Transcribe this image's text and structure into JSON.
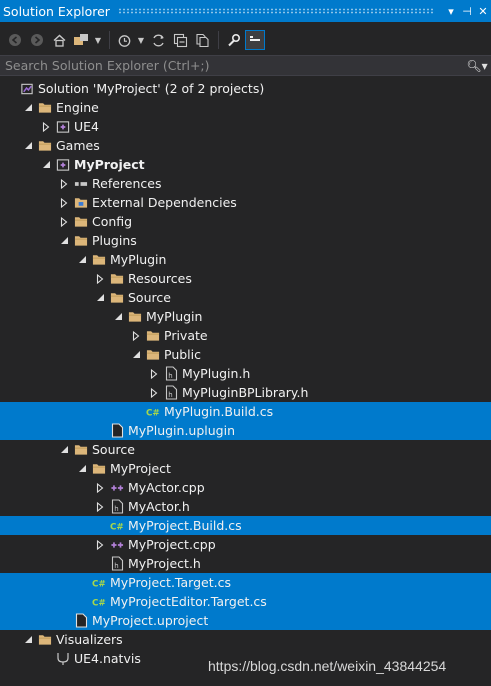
{
  "window": {
    "title": "Solution Explorer",
    "buttons": [
      "▾",
      "⊣",
      "✕"
    ]
  },
  "search": {
    "placeholder": "Search Solution Explorer (Ctrl+;)",
    "value": ""
  },
  "colors": {
    "accent": "#007acc",
    "background": "#252526",
    "folder": "#dcb67a",
    "cs": "#a6d74c",
    "cpp": "#b180d7"
  },
  "tree": [
    {
      "label": "Solution 'MyProject' (2 of 2 projects)",
      "icon": "solution-icon",
      "expander": "none",
      "indent": 0
    },
    {
      "label": "Engine",
      "icon": "folder-icon",
      "expander": "expanded",
      "indent": 1
    },
    {
      "label": "UE4",
      "icon": "cpp-project-icon",
      "expander": "collapsed",
      "indent": 2
    },
    {
      "label": "Games",
      "icon": "folder-icon",
      "expander": "expanded",
      "indent": 1
    },
    {
      "label": "MyProject",
      "icon": "cpp-project-icon",
      "expander": "expanded",
      "indent": 2,
      "bold": true
    },
    {
      "label": "References",
      "icon": "references-icon",
      "expander": "collapsed",
      "indent": 3
    },
    {
      "label": "External Dependencies",
      "icon": "external-deps-icon",
      "expander": "collapsed",
      "indent": 3
    },
    {
      "label": "Config",
      "icon": "folder-icon",
      "expander": "collapsed",
      "indent": 3
    },
    {
      "label": "Plugins",
      "icon": "folder-icon",
      "expander": "expanded",
      "indent": 3
    },
    {
      "label": "MyPlugin",
      "icon": "folder-icon",
      "expander": "expanded",
      "indent": 4
    },
    {
      "label": "Resources",
      "icon": "folder-icon",
      "expander": "collapsed",
      "indent": 5
    },
    {
      "label": "Source",
      "icon": "folder-icon",
      "expander": "expanded",
      "indent": 5
    },
    {
      "label": "MyPlugin",
      "icon": "folder-icon",
      "expander": "expanded",
      "indent": 6
    },
    {
      "label": "Private",
      "icon": "folder-icon",
      "expander": "collapsed",
      "indent": 7
    },
    {
      "label": "Public",
      "icon": "folder-icon",
      "expander": "expanded",
      "indent": 7
    },
    {
      "label": "MyPlugin.h",
      "icon": "header-file-icon",
      "expander": "collapsed",
      "indent": 8
    },
    {
      "label": "MyPluginBPLibrary.h",
      "icon": "header-file-icon",
      "expander": "collapsed",
      "indent": 8
    },
    {
      "label": "MyPlugin.Build.cs",
      "icon": "csharp-file-icon",
      "expander": "none",
      "indent": 7,
      "selected": true
    },
    {
      "label": "MyPlugin.uplugin",
      "icon": "file-icon",
      "expander": "none",
      "indent": 5,
      "selected": true
    },
    {
      "label": "Source",
      "icon": "folder-icon",
      "expander": "expanded",
      "indent": 3
    },
    {
      "label": "MyProject",
      "icon": "folder-icon",
      "expander": "expanded",
      "indent": 4
    },
    {
      "label": "MyActor.cpp",
      "icon": "cpp-file-icon",
      "expander": "collapsed",
      "indent": 5
    },
    {
      "label": "MyActor.h",
      "icon": "header-file-icon",
      "expander": "collapsed",
      "indent": 5
    },
    {
      "label": "MyProject.Build.cs",
      "icon": "csharp-file-icon",
      "expander": "none",
      "indent": 5,
      "selected": true
    },
    {
      "label": "MyProject.cpp",
      "icon": "cpp-file-icon",
      "expander": "collapsed",
      "indent": 5
    },
    {
      "label": "MyProject.h",
      "icon": "header-file-icon",
      "expander": "none",
      "indent": 5
    },
    {
      "label": "MyProject.Target.cs",
      "icon": "csharp-file-icon",
      "expander": "none",
      "indent": 4,
      "selected": true
    },
    {
      "label": "MyProjectEditor.Target.cs",
      "icon": "csharp-file-icon",
      "expander": "none",
      "indent": 4,
      "selected": true
    },
    {
      "label": "MyProject.uproject",
      "icon": "file-icon",
      "expander": "none",
      "indent": 3,
      "selected": true
    },
    {
      "label": "Visualizers",
      "icon": "folder-icon",
      "expander": "expanded",
      "indent": 1
    },
    {
      "label": "UE4.natvis",
      "icon": "natvis-file-icon",
      "expander": "none",
      "indent": 2
    }
  ],
  "watermark": "https://blog.csdn.net/weixin_43844254"
}
